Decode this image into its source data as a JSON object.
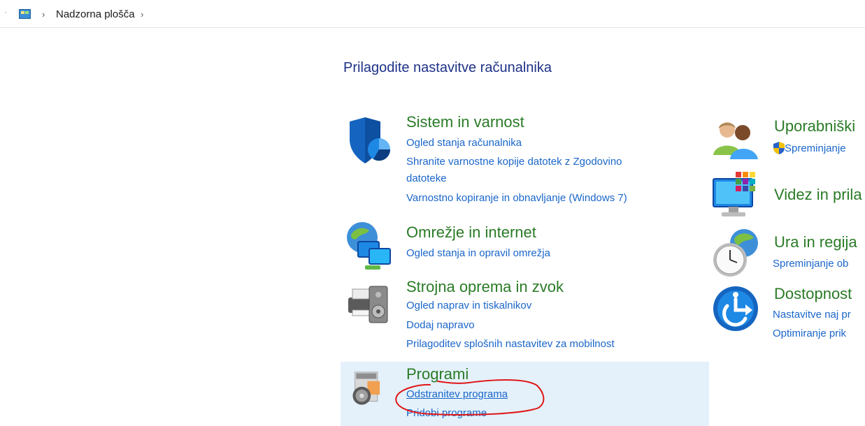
{
  "breadcrumb": {
    "items": [
      "Nadzorna plošča"
    ]
  },
  "page": {
    "title": "Prilagodite nastavitve računalnika"
  },
  "left_categories": [
    {
      "name": "system-security",
      "icon": "shield-icon",
      "title": "Sistem in varnost",
      "links": [
        "Ogled stanja računalnika",
        "Shranite varnostne kopije datotek z Zgodovino",
        "datoteke",
        "Varnostno kopiranje in obnavljanje (Windows 7)"
      ]
    },
    {
      "name": "network-internet",
      "icon": "network-globe-icon",
      "title": "Omrežje in internet",
      "links": [
        "Ogled stanja in opravil omrežja"
      ]
    },
    {
      "name": "hardware-sound",
      "icon": "printer-speaker-icon",
      "title": "Strojna oprema in zvok",
      "links": [
        "Ogled naprav in tiskalnikov",
        "Dodaj napravo",
        "Prilagoditev splošnih nastavitev za mobilnost"
      ]
    },
    {
      "name": "programs",
      "icon": "programs-disc-icon",
      "title": "Programi",
      "links": [
        "Odstranitev programa",
        "Pridobi programe"
      ]
    }
  ],
  "right_categories": [
    {
      "name": "user-accounts",
      "icon": "users-icon",
      "title": "Uporabniški",
      "links": [
        "Spreminjanje"
      ]
    },
    {
      "name": "appearance",
      "icon": "monitor-colors-icon",
      "title": "Videz in prila",
      "links": []
    },
    {
      "name": "clock-region",
      "icon": "clock-globe-icon",
      "title": "Ura in regija",
      "links": [
        "Spreminjanje ob"
      ]
    },
    {
      "name": "ease-of-access",
      "icon": "accessibility-icon",
      "title": "Dostopnost",
      "links": [
        "Nastavitve naj pr",
        "Optimiranje prik"
      ]
    }
  ],
  "colors": {
    "title_blue": "#1e3287",
    "category_green": "#2a7b26",
    "link_blue": "#1a66c9",
    "hover_bg": "#e4f1fb",
    "annotation_red": "#e01616"
  }
}
